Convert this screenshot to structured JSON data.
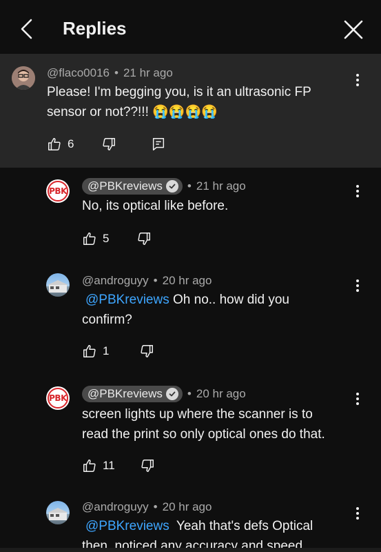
{
  "header": {
    "title": "Replies"
  },
  "parent": {
    "handle": "@flaco0016",
    "time": "21 hr ago",
    "lines": [
      "Please! I'm begging you, is it an ultrasonic FP",
      "sensor or not??!!! 😭😭😭😭"
    ],
    "likes": "6"
  },
  "replies": [
    {
      "handle": "@PBKreviews",
      "time": "21 hr ago",
      "text": "No, its optical like before.",
      "likes": "5",
      "avatar_text": "PBK"
    },
    {
      "handle": "@androguyy",
      "time": "20 hr ago",
      "mention": "@PBKreviews",
      "text_after": " Oh no.. how did you",
      "line2": "confirm?",
      "likes": "1"
    },
    {
      "handle": "@PBKreviews",
      "time": "20 hr ago",
      "line1": "screen lights up where the scanner is to",
      "line2": "read the print so only optical ones do that.",
      "likes": "11",
      "avatar_text": "PBK"
    },
    {
      "handle": "@androguyy",
      "time": "20 hr ago",
      "mention": "@PBKreviews",
      "text_after": "  Yeah that's defs Optical",
      "line2": "then, noticed any accuracy and speed"
    }
  ],
  "dot": "•",
  "colors": {
    "background": "#0f0f0f",
    "parent_bg": "#272727",
    "mention": "#3ea6ff",
    "pbk_red": "#d8262b"
  }
}
